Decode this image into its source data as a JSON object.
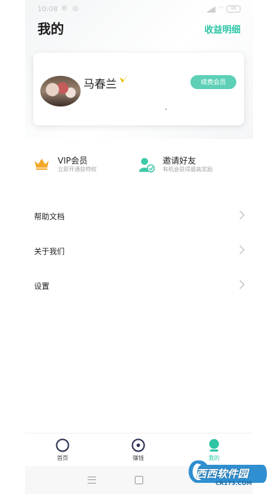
{
  "status": {
    "time": "10:08",
    "battery": "88"
  },
  "header": {
    "title": "我的",
    "earnings_link": "收益明细"
  },
  "profile": {
    "name": "马春兰",
    "renew_label": "续费会员"
  },
  "features": [
    {
      "title": "VIP会员",
      "subtitle": "立即开通获特权",
      "icon": "crown-icon",
      "color": "#f3a92b"
    },
    {
      "title": "邀请好友",
      "subtitle": "有机会获得最高奖励",
      "icon": "add-user-icon",
      "color": "#3ec8a8"
    }
  ],
  "menu": [
    {
      "label": "帮助文档"
    },
    {
      "label": "关于我们"
    },
    {
      "label": "设置"
    }
  ],
  "tabs": [
    {
      "label": "首页",
      "icon": "home-circle-icon"
    },
    {
      "label": "赚钱",
      "icon": "earn-icon"
    },
    {
      "label": "我的",
      "icon": "profile-icon",
      "active": true
    }
  ],
  "watermark": {
    "text": "西西软件园",
    "url": "CR173.COM"
  },
  "colors": {
    "accent": "#2ec5a5",
    "renew": "#5dd0b6",
    "vip": "#f3a92b"
  }
}
